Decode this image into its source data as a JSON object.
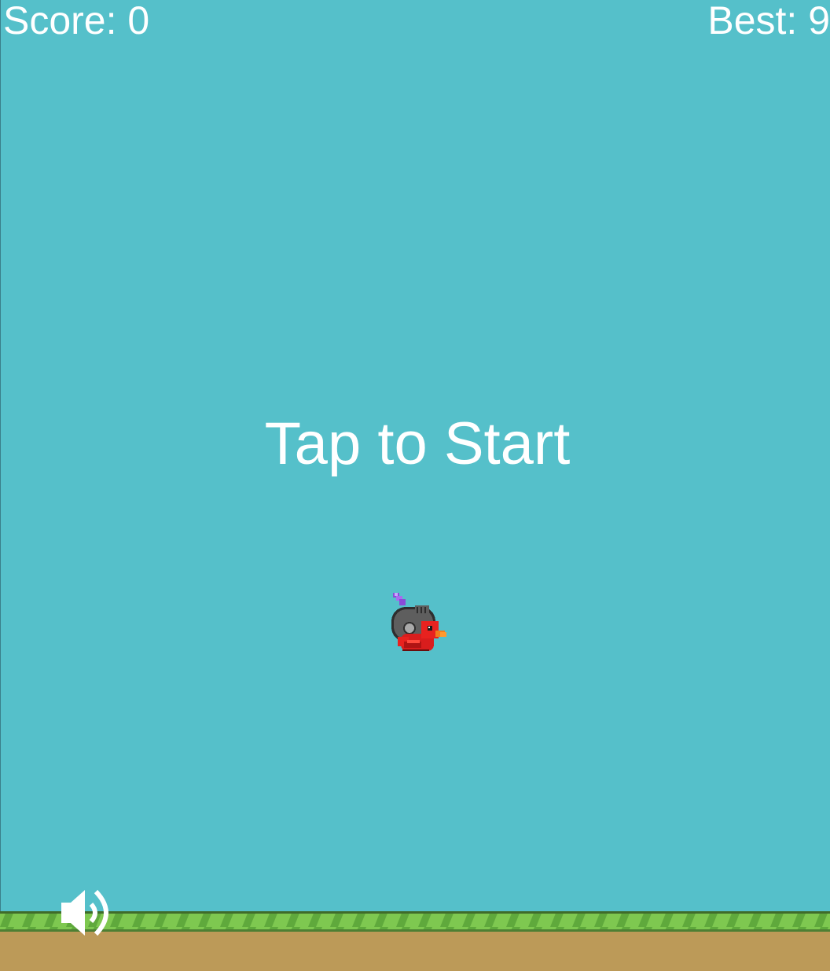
{
  "hud": {
    "score_text": "Score: 0",
    "best_text": "Best: 9"
  },
  "message": {
    "start_text": "Tap to Start"
  },
  "sprites": {
    "player_icon": "knight-helmet-red-bird",
    "sound_icon": "speaker-on-icon"
  },
  "colors": {
    "sky": "#55c0ca",
    "grass": "#7ec850",
    "grass_stripe": "#5fa93c",
    "dirt": "#bc9a58",
    "text": "#ffffff"
  }
}
